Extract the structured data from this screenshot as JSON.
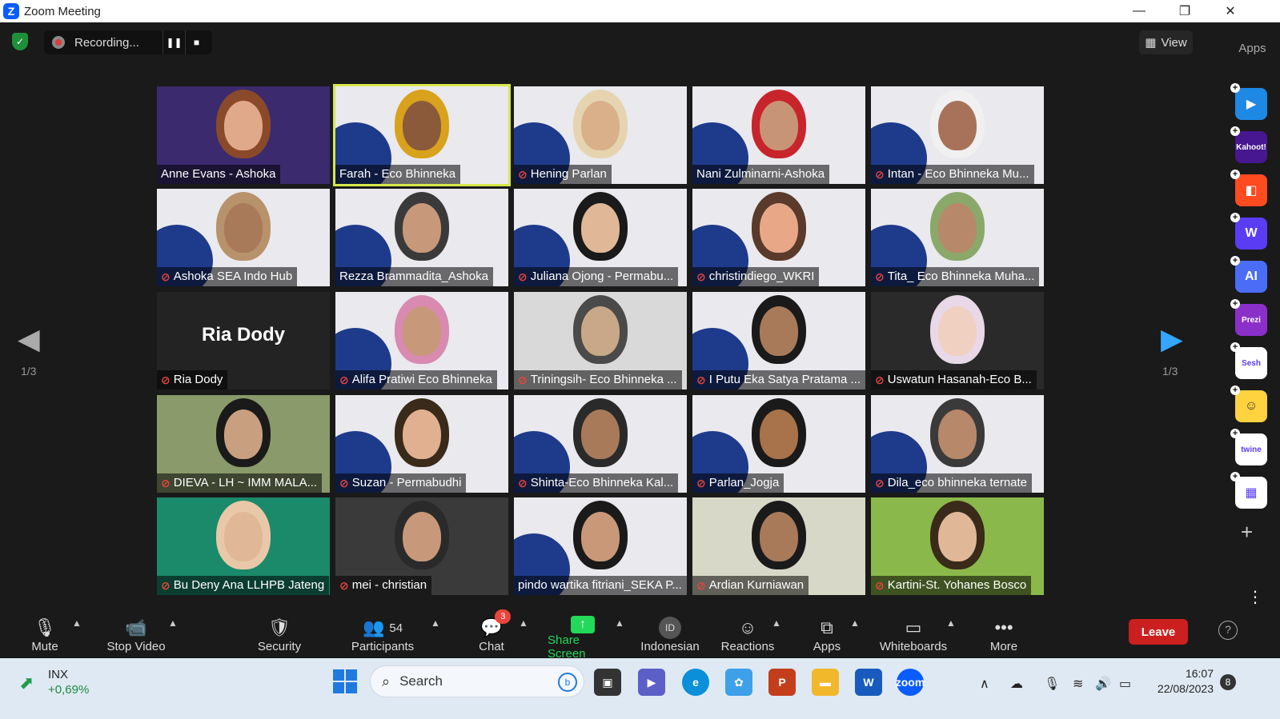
{
  "window": {
    "title": "Zoom Meeting",
    "minimize": "—",
    "restore": "❐",
    "close": "✕"
  },
  "top": {
    "recording_label": "Recording...",
    "pause": "❚❚",
    "stop": "■",
    "view_label": "View",
    "view_icon": "▦"
  },
  "apps_panel": {
    "title": "Apps",
    "items": [
      {
        "name": "Flip",
        "color": "#1e88e5",
        "text": "▶"
      },
      {
        "name": "Kahoot!",
        "color": "#46178f",
        "text": "Kahoot!"
      },
      {
        "name": "Rumble",
        "color": "#ff4b1f",
        "text": "◧"
      },
      {
        "name": "Wooclap",
        "color": "#5b3cf5",
        "text": "W"
      },
      {
        "name": "AI app",
        "color": "#4a6cf7",
        "text": "AI"
      },
      {
        "name": "Prezi",
        "color": "#8b2fc9",
        "text": "Prezi"
      },
      {
        "name": "Sesh",
        "color": "#ffffff",
        "text": "Sesh"
      },
      {
        "name": "Emoji",
        "color": "#ffd23f",
        "text": "☺"
      },
      {
        "name": "Twine",
        "color": "#ffffff",
        "text": "twine"
      },
      {
        "name": "Blocks",
        "color": "#ffffff",
        "text": "▦"
      }
    ],
    "add": "+",
    "more": "⋮",
    "help": "?"
  },
  "nav": {
    "prev": "◀",
    "next": "▶",
    "page_left": "1/3",
    "page_right": "1/3"
  },
  "participants": [
    {
      "name": "Anne Evans - Ashoka",
      "muted": false,
      "bg": "#3b2a6e",
      "face": "#e0a98a",
      "hair": "#8a4a2a"
    },
    {
      "name": "Farah - Eco Bhinneka",
      "muted": false,
      "bg": "#e9e9ee",
      "face": "#8a5a3a",
      "hair": "#d9a21c"
    },
    {
      "name": "Hening Parlan",
      "muted": true,
      "bg": "#e9e9ee",
      "face": "#d9b08a",
      "hair": "#e6d4b0"
    },
    {
      "name": "Nani Zulminarni-Ashoka",
      "muted": false,
      "bg": "#e9e9ee",
      "face": "#c89478",
      "hair": "#c8242c"
    },
    {
      "name": "Intan - Eco Bhinneka Mu...",
      "muted": true,
      "bg": "#e9e9ee",
      "face": "#a8725a",
      "hair": "#f0f0f0"
    },
    {
      "name": "Ashoka SEA Indo Hub",
      "muted": true,
      "bg": "#e9e9ee",
      "face": "#a87a5a",
      "hair": "#b8926a"
    },
    {
      "name": "Rezza Brammadita_Ashoka",
      "muted": false,
      "bg": "#e9e9ee",
      "face": "#c8987a",
      "hair": "#3a3a3a"
    },
    {
      "name": "Juliana Ojong - Permabu...",
      "muted": true,
      "bg": "#e9e9ee",
      "face": "#e0b898",
      "hair": "#1a1a1a"
    },
    {
      "name": "christindiego_WKRI",
      "muted": true,
      "bg": "#e9e9ee",
      "face": "#e8a888",
      "hair": "#5a3a2a"
    },
    {
      "name": "Tita_ Eco Bhinneka Muha...",
      "muted": true,
      "bg": "#e9e9ee",
      "face": "#b8886a",
      "hair": "#8aa86a"
    },
    {
      "name": "Ria Dody",
      "muted": true,
      "bg": "#232323",
      "face": "",
      "hair": "",
      "initials": "Ria Dody"
    },
    {
      "name": "Alifa Pratiwi Eco Bhinneka",
      "muted": true,
      "bg": "#e9e9ee",
      "face": "#c8987a",
      "hair": "#d88ab0"
    },
    {
      "name": "Triningsih- Eco Bhinneka ...",
      "muted": true,
      "bg": "#d9d9d9",
      "face": "#c8a888",
      "hair": "#4a4a4a"
    },
    {
      "name": "I Putu Eka Satya Pratama ...",
      "muted": true,
      "bg": "#e9e9ee",
      "face": "#a87a5a",
      "hair": "#1a1a1a"
    },
    {
      "name": "Uswatun Hasanah-Eco B...",
      "muted": true,
      "bg": "#2a2a2a",
      "face": "#f0d0c0",
      "hair": "#e8d8e8"
    },
    {
      "name": "DIEVA - LH ~ IMM MALA...",
      "muted": true,
      "bg": "#8a9a6a",
      "face": "#c8a080",
      "hair": "#1a1a1a"
    },
    {
      "name": "Suzan - Permabudhi",
      "muted": true,
      "bg": "#e9e9ee",
      "face": "#e0b090",
      "hair": "#3a2a1a"
    },
    {
      "name": "Shinta-Eco Bhinneka Kal...",
      "muted": true,
      "bg": "#e9e9ee",
      "face": "#a87a5a",
      "hair": "#2a2a2a"
    },
    {
      "name": "Parlan_Jogja",
      "muted": true,
      "bg": "#e9e9ee",
      "face": "#a8724a",
      "hair": "#1a1a1a"
    },
    {
      "name": "Dila_eco bhinneka ternate",
      "muted": true,
      "bg": "#e9e9ee",
      "face": "#b8886a",
      "hair": "#3a3a3a"
    },
    {
      "name": "Bu Deny Ana LLHPB Jateng",
      "muted": true,
      "bg": "#1a8a6a",
      "face": "#e0b898",
      "hair": "#e8c8a8"
    },
    {
      "name": "mei - christian",
      "muted": true,
      "bg": "#3a3a3a",
      "face": "#c8987a",
      "hair": "#2a2a2a"
    },
    {
      "name": "pindo wartika fitriani_SEKA P...",
      "muted": false,
      "bg": "#e9e9ee",
      "face": "#c89878",
      "hair": "#1a1a1a"
    },
    {
      "name": "Ardian Kurniawan",
      "muted": true,
      "bg": "#d8d8c8",
      "face": "#a87a5a",
      "hair": "#1a1a1a"
    },
    {
      "name": "Kartini-St. Yohanes Bosco",
      "muted": true,
      "bg": "#8ab84a",
      "face": "#e0b898",
      "hair": "#3a2a1a"
    }
  ],
  "toolbar": {
    "mute": "Mute",
    "stop_video": "Stop Video",
    "security": "Security",
    "participants": "Participants",
    "participants_count": "54",
    "chat": "Chat",
    "chat_badge": "3",
    "share_screen": "Share Screen",
    "language": "Indonesian",
    "language_icon": "ID",
    "reactions": "Reactions",
    "apps": "Apps",
    "whiteboards": "Whiteboards",
    "more": "More",
    "leave": "Leave",
    "accent": "#0e71eb",
    "share_color": "#23d959"
  },
  "taskbar": {
    "ticker": "INX",
    "ticker_change": "+0,69%",
    "search_placeholder": "Search",
    "time": "16:07",
    "date": "22/08/2023",
    "notif_count": "8"
  }
}
